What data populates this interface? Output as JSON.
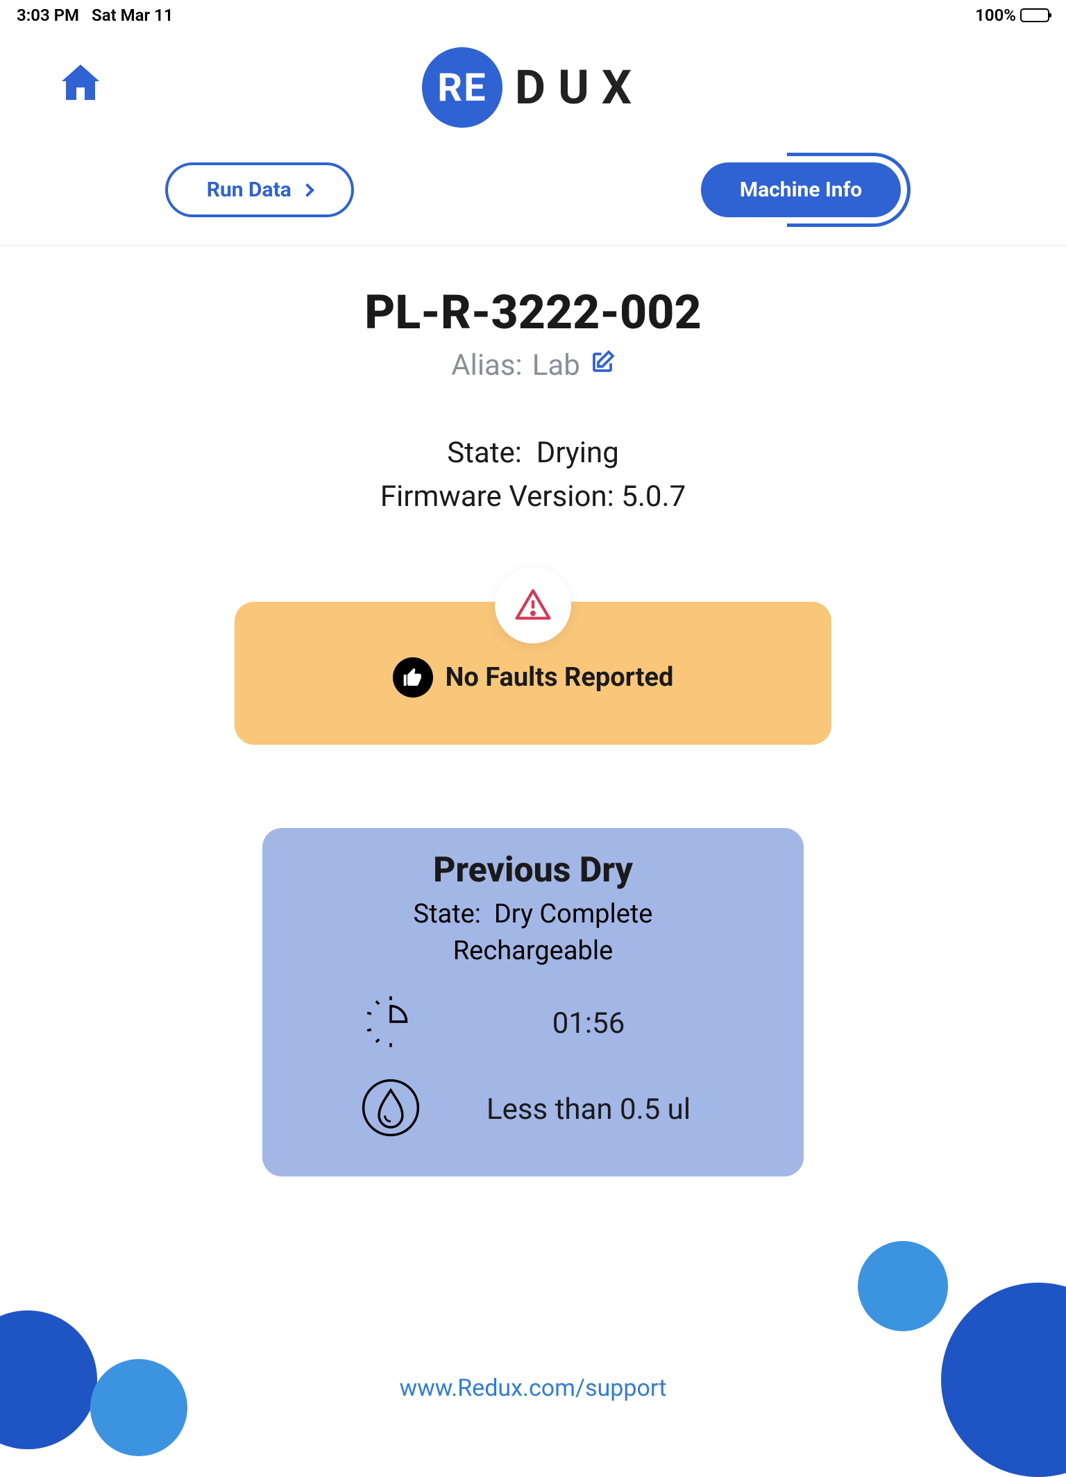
{
  "status": {
    "time": "3:03 PM",
    "date": "Sat Mar 11",
    "battery": "100%"
  },
  "logo": {
    "circle": "RE",
    "rest": "DUX"
  },
  "tabs": {
    "run_data": "Run Data",
    "machine_info": "Machine Info"
  },
  "machine": {
    "id": "PL-R-3222-002",
    "alias_label": "Alias:",
    "alias_value": "Lab",
    "state_label": "State:",
    "state_value": "Drying",
    "firmware_label": "Firmware Version:",
    "firmware_value": "5.0.7"
  },
  "faults": {
    "message": "No Faults Reported"
  },
  "previous": {
    "title": "Previous Dry",
    "state_label": "State:",
    "state_line1": "Dry Complete",
    "state_line2": "Rechargeable",
    "duration": "01:56",
    "moisture": "Less than 0.5 ul"
  },
  "footer": {
    "support_link": "www.Redux.com/support"
  }
}
